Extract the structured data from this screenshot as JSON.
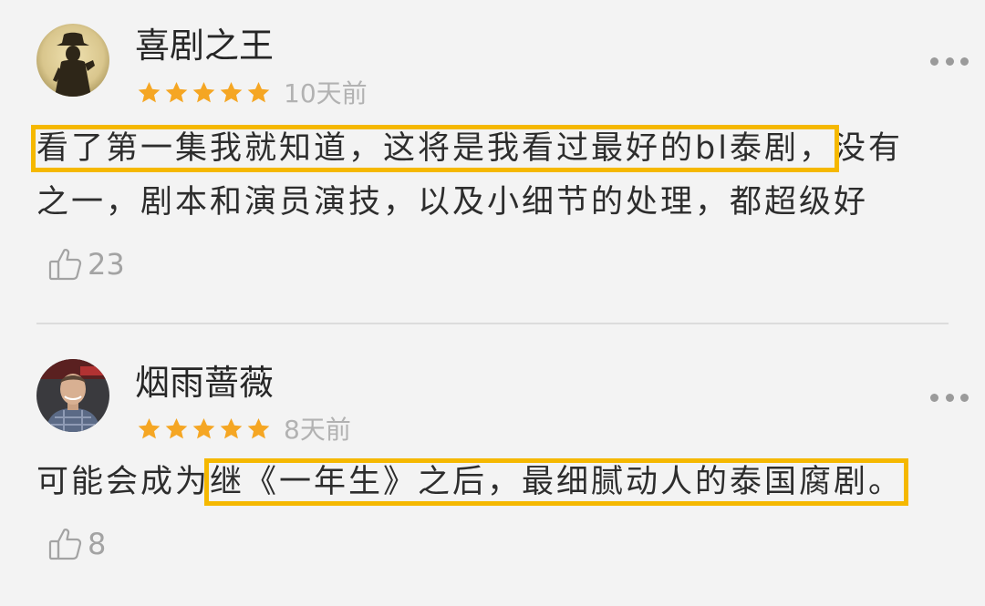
{
  "comments": [
    {
      "username": "喜剧之王",
      "rating": 5,
      "time": "10天前",
      "avatar_icon": "cowboy-silhouette-avatar",
      "text_line1_highlight": "看了第一集我就知道，这将是我看过最好的bl泰剧，",
      "text_line1_rest": "没有",
      "text_line2": "之一，剧本和演员演技，以及小细节的处理，都超级好",
      "likes": "23"
    },
    {
      "username": "烟雨蔷薇",
      "rating": 5,
      "time": "8天前",
      "avatar_icon": "man-portrait-avatar",
      "text_plain": "可能会成为",
      "text_highlight": "继《一年生》之后，最细腻动人的泰国腐剧。",
      "likes": "8"
    }
  ],
  "colors": {
    "star": "#f5a623",
    "highlight_box": "#f5b800",
    "background": "#f3f3f3",
    "divider": "#dcdcdc"
  },
  "icons": {
    "star": "star-icon",
    "more": "more-dots-icon",
    "like": "thumbs-up-icon"
  }
}
